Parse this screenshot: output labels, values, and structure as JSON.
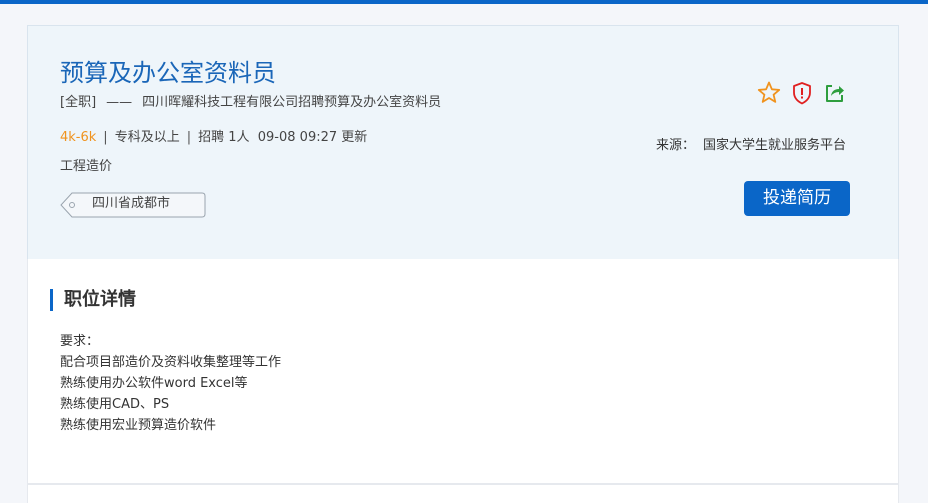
{
  "job": {
    "title": "预算及办公室资料员",
    "type": "[全职]",
    "dash": "——",
    "company_line": "四川晖耀科技工程有限公司招聘预算及办公室资料员",
    "salary": "4k-6k",
    "separator": "|",
    "education": "专科及以上",
    "headcount": "招聘 1人",
    "updated": "09-08 09:27 更新",
    "category": "工程造价",
    "location": "四川省成都市"
  },
  "actions": {
    "favorite_icon": "star-icon",
    "report_icon": "shield-icon",
    "share_icon": "share-icon",
    "apply_label": "投递简历"
  },
  "source": {
    "label": "来源：",
    "value": "国家大学生就业服务平台"
  },
  "details": {
    "heading": "职位详情",
    "lines": [
      "要求：",
      "配合项目部造价及资料收集整理等工作",
      "熟练使用办公软件word Excel等",
      "熟练使用CAD、PS",
      "熟练使用宏业预算造价软件"
    ]
  },
  "colors": {
    "accent": "#0a66c8",
    "title": "#1a66b8",
    "salary": "#f0931e",
    "star": "#f0931e",
    "report": "#e02020",
    "share": "#2e9e3e",
    "card_bg": "#eef5fa"
  }
}
